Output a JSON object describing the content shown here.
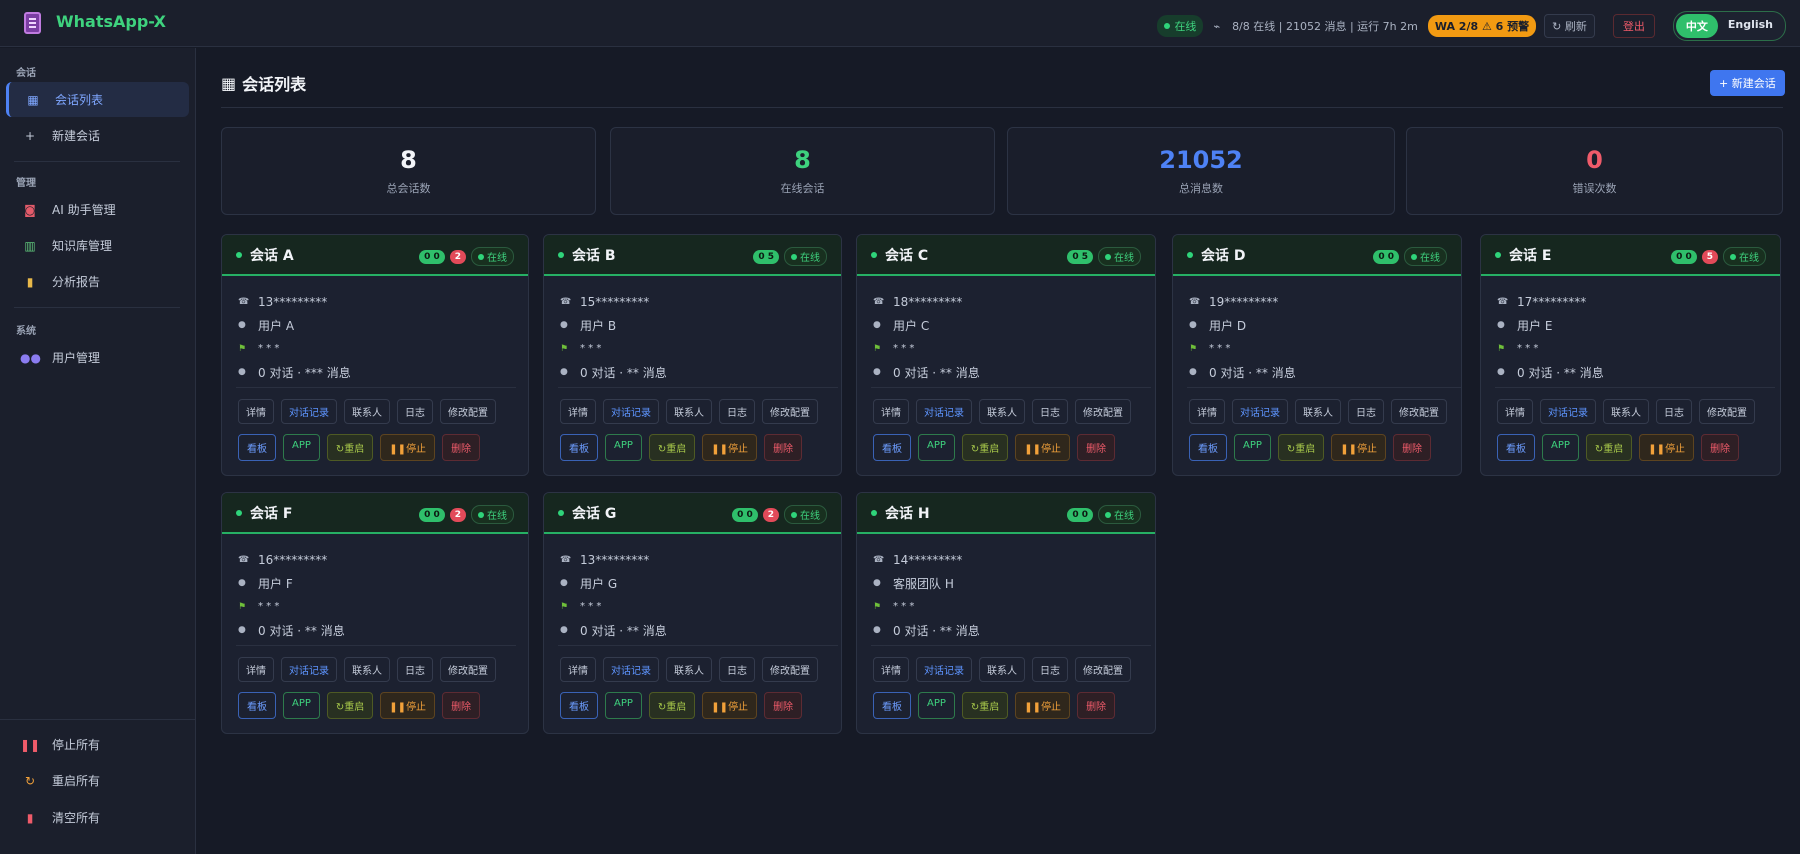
{
  "app": {
    "title": "WhatsApp-X"
  },
  "topbar": {
    "online_label": "在线",
    "stats_text": "8/8 在线 | 21052 消息 | 运行 7h 2m",
    "wa_badge": "WA 2/8 ⚠ 6 预警",
    "refresh_label": "刷新",
    "logout_label": "登出",
    "lang_zh": "中文",
    "lang_en": "English"
  },
  "sidebar": {
    "section_session": "会话",
    "section_manage": "管理",
    "section_system": "系统",
    "items": {
      "session_list": "会话列表",
      "new_session": "新建会话",
      "ai_assistant": "AI 助手管理",
      "knowledge": "知识库管理",
      "reports": "分析报告",
      "users": "用户管理"
    },
    "bottom": {
      "stop_all": "停止所有",
      "restart_all": "重启所有",
      "clear_all": "清空所有"
    }
  },
  "main": {
    "title": "会话列表",
    "new_button": "+ 新建会话",
    "stats": [
      {
        "value": "8",
        "label": "总会话数",
        "color": "#f2f4f8"
      },
      {
        "value": "8",
        "label": "在线会话",
        "color": "#3ed27e"
      },
      {
        "value": "21052",
        "label": "总消息数",
        "color": "#4e82f5"
      },
      {
        "value": "0",
        "label": "错误次数",
        "color": "#ef5b6a"
      }
    ],
    "card_labels": {
      "online": "在线",
      "details": "详情",
      "chat_records": "对话记录",
      "contacts": "联系人",
      "logs": "日志",
      "edit_config": "修改配置",
      "board": "看板",
      "app": "APP",
      "restart": "重启",
      "stop": "停止",
      "delete": "删除",
      "flag_text": "* * *"
    },
    "sessions": [
      {
        "name": "会话 A",
        "green_badge": "0 0",
        "red_badge": "2",
        "phone": "13*********",
        "user": "用户 A",
        "stats": "0 对话 · *** 消息"
      },
      {
        "name": "会话 B",
        "green_badge": "0 5",
        "red_badge": "",
        "phone": "15*********",
        "user": "用户 B",
        "stats": "0 对话 · ** 消息"
      },
      {
        "name": "会话 C",
        "green_badge": "0 5",
        "red_badge": "",
        "phone": "18*********",
        "user": "用户 C",
        "stats": "0 对话 · ** 消息"
      },
      {
        "name": "会话 D",
        "green_badge": "0 0",
        "red_badge": "",
        "phone": "19*********",
        "user": "用户 D",
        "stats": "0 对话 · ** 消息"
      },
      {
        "name": "会话 E",
        "green_badge": "0 0",
        "red_badge": "5",
        "phone": "17*********",
        "user": "用户 E",
        "stats": "0 对话 · ** 消息"
      },
      {
        "name": "会话 F",
        "green_badge": "0 0",
        "red_badge": "2",
        "phone": "16*********",
        "user": "用户 F",
        "stats": "0 对话 · ** 消息"
      },
      {
        "name": "会话 G",
        "green_badge": "0 0",
        "red_badge": "2",
        "phone": "13*********",
        "user": "用户 G",
        "stats": "0 对话 · ** 消息"
      },
      {
        "name": "会话 H",
        "green_badge": "0 0",
        "red_badge": "",
        "phone": "14*********",
        "user": "客服团队 H",
        "stats": "0 对话 · ** 消息"
      }
    ]
  }
}
